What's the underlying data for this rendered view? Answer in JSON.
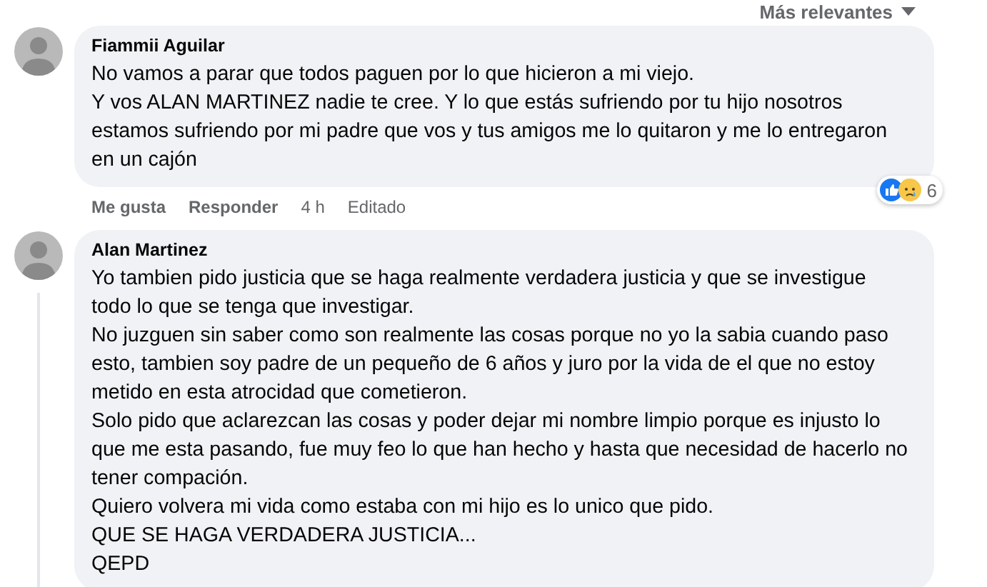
{
  "sort_menu": {
    "label": "Más relevantes"
  },
  "comments": [
    {
      "author": "Fiammii Aguilar",
      "paragraphs": [
        "No vamos a parar que todos paguen por lo que hicieron a mi viejo.",
        "Y vos ALAN MARTINEZ nadie te cree. Y lo que estás sufriendo por tu hijo nosotros estamos sufriendo por mi padre que vos y tus amigos me lo quitaron y me lo entregaron en un cajón"
      ],
      "actions": [
        "Me gusta",
        "Responder"
      ],
      "time": "4 h",
      "edited": "Editado",
      "reactions": {
        "count": "6"
      },
      "thread_line": false
    },
    {
      "author": "Alan Martinez",
      "paragraphs": [
        "Yo tambien pido justicia que se haga realmente verdadera justicia y que se investigue todo lo que se tenga que investigar.",
        "No juzguen sin saber como son realmente las cosas porque no yo la sabia cuando paso esto, tambien soy padre de un pequeño de 6 años y juro por la vida de el que no estoy metido en esta atrocidad que cometieron.",
        "Solo pido que aclarezcan las cosas y poder dejar mi nombre limpio porque es injusto lo que me esta pasando, fue muy feo lo que han hecho y hasta que necesidad de hacerlo no tener compación.",
        "Quiero volvera mi vida como estaba con mi hijo es lo unico que pido.",
        "QUE SE HAGA VERDADERA JUSTICIA...",
        "QEPD"
      ],
      "thread_line": true
    }
  ]
}
